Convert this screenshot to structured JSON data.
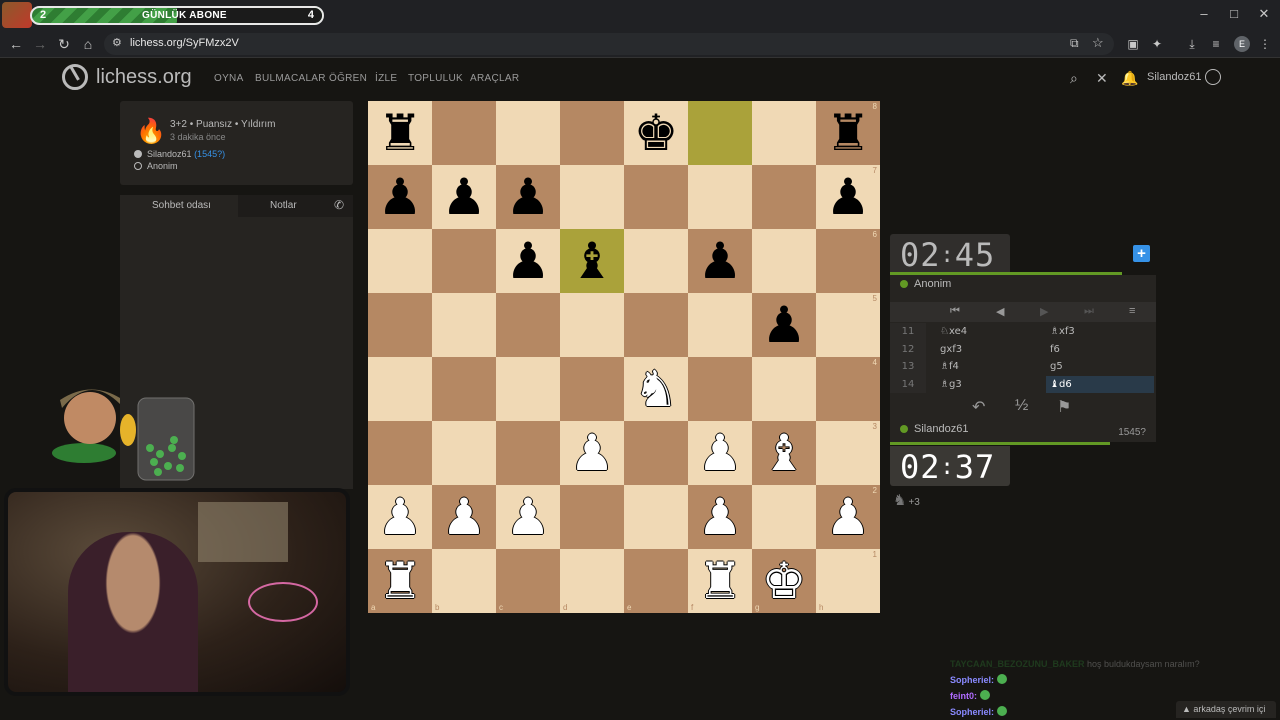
{
  "overlay": {
    "sub_goal": {
      "current": "2",
      "title": "GÜNLÜK ABONE",
      "target": "4",
      "progress": 0.5
    }
  },
  "browser": {
    "url": "lichess.org/SyFMzx2V",
    "profile_initial": "E",
    "window_controls": [
      "–",
      "□",
      "✕"
    ]
  },
  "header": {
    "logo": "lichess.org",
    "nav": [
      "OYNA",
      "BULMACALAR",
      "ÖĞREN",
      "İZLE",
      "TOPLULUK",
      "ARAÇLAR"
    ],
    "username": "Silandoz61"
  },
  "game_info": {
    "type": "3+2 • Puansız • Yıldırım",
    "when": "3 dakika önce",
    "player_white": "Silandoz61",
    "player_white_rating": "(1545?)",
    "player_black": "Anonim"
  },
  "chat": {
    "tabs": [
      "Sohbet odası",
      "Notlar"
    ]
  },
  "board": {
    "pieces": {
      "a8": "bR",
      "e8": "bK",
      "h8": "bR",
      "a7": "bP",
      "b7": "bP",
      "c7": "bP",
      "h7": "bP",
      "c6": "bP",
      "d6": "bB",
      "f6": "bP",
      "g5": "bP",
      "e4": "wN",
      "d3": "wP",
      "f3": "wP",
      "g3": "wB",
      "a2": "wP",
      "b2": "wP",
      "c2": "wP",
      "f2": "wP",
      "h2": "wP",
      "a1": "wR",
      "f1": "wR",
      "g1": "wK"
    },
    "last_move": [
      "f8",
      "d6"
    ],
    "files": [
      "a",
      "b",
      "c",
      "d",
      "e",
      "f",
      "g",
      "h"
    ],
    "ranks": [
      "8",
      "7",
      "6",
      "5",
      "4",
      "3",
      "2",
      "1"
    ]
  },
  "clocks": {
    "top": {
      "m": "02",
      "s": "45"
    },
    "bottom": {
      "m": "02",
      "s": "37"
    }
  },
  "players": {
    "top": {
      "name": "Anonim"
    },
    "bottom": {
      "name": "Silandoz61",
      "rating": "1545?"
    }
  },
  "moves": [
    {
      "n": "11",
      "w": "♘xe4",
      "b": "♗xf3"
    },
    {
      "n": "12",
      "w": "gxf3",
      "b": "f6"
    },
    {
      "n": "13",
      "w": "♗f4",
      "b": "g5"
    },
    {
      "n": "14",
      "w": "♗g3",
      "b": "♝d6",
      "active": true
    }
  ],
  "material": {
    "piece": "♞",
    "diff": "+3"
  },
  "stream_chat": [
    {
      "user": "TAYCAAN_BEZOZUNU_BAKER",
      "text": "hoş buldukdaysam naralım?",
      "color": "#2e7d32",
      "faded": true
    },
    {
      "user": "Sopheriel:",
      "text": "",
      "color": "#8a8aff"
    },
    {
      "user": "feint0:",
      "text": "",
      "color": "#b06cff"
    },
    {
      "user": "Sopheriel:",
      "text": "",
      "color": "#8a8aff"
    }
  ],
  "friends_online": "▲ arkadaş çevrim içi",
  "colors": {
    "bar_green": "#629924",
    "link_blue": "#3692e7",
    "board_light": "#f0d9b5",
    "board_dark": "#b58863",
    "highlight": "#aaa23a"
  }
}
